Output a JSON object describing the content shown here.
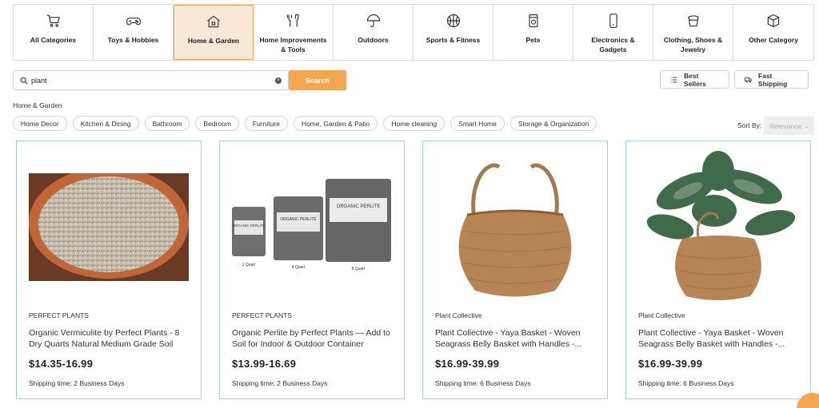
{
  "categories": [
    {
      "label": "All Categories",
      "icon": "cart-icon"
    },
    {
      "label": "Toys & Hobbies",
      "icon": "gamepad-icon"
    },
    {
      "label": "Home & Garden",
      "icon": "house-icon",
      "active": true
    },
    {
      "label": "Home Improvements & Tools",
      "icon": "tools-icon"
    },
    {
      "label": "Outdoors",
      "icon": "umbrella-icon"
    },
    {
      "label": "Sports & Fitness",
      "icon": "basketball-icon"
    },
    {
      "label": "Pets",
      "icon": "pet-food-icon"
    },
    {
      "label": "Electronics & Gadgets",
      "icon": "phone-icon"
    },
    {
      "label": "Clothing, Shoes & Jewelry",
      "icon": "hat-icon"
    },
    {
      "label": "Other Category",
      "icon": "box-icon"
    }
  ],
  "search": {
    "value": "plant",
    "button_label": "Search"
  },
  "toolbar": {
    "best_sellers": "Best Sellers",
    "fast_shipping": "Fast Shipping"
  },
  "breadcrumb": "Home & Garden",
  "subcategories": [
    "Home Decor",
    "Kitchen & Dining",
    "Bathroom",
    "Bedroom",
    "Furniture",
    "Home, Garden & Patio",
    "Home cleaning",
    "Smart Home",
    "Storage & Organization"
  ],
  "sort": {
    "label": "Sort By:",
    "value": "Relevance"
  },
  "products": [
    {
      "brand": "PERFECT PLANTS",
      "title": "Organic Vermiculite by Perfect Plants - 8 Dry Quarts Natural Medium Grade Soil Additive...",
      "price": "$14.35-16.99",
      "shipping": "Shipping time: 2 Business Days",
      "image": "vermiculite-pot"
    },
    {
      "brand": "PERFECT PLANTS",
      "title": "Organic Perlite by Perfect Plants — Add to Soil for Indoor & Outdoor Container Plants...",
      "price": "$13.99-16.69",
      "shipping": "Shipping time: 2 Business Days",
      "image": "perlite-bags",
      "bag_labels": [
        "1 Quart",
        "4 Quart",
        "8 Quart"
      ],
      "bag_brand": "ORGANIC PERLITE"
    },
    {
      "brand": "Plant Collective",
      "title": "Plant Collective - Yaya Basket - Woven Seagrass Belly Basket with Handles -...",
      "price": "$16.99-39.99",
      "shipping": "Shipping time: 6 Business Days",
      "image": "woven-basket"
    },
    {
      "brand": "Plant Collective",
      "title": "Plant Collective - Yaya Basket - Woven Seagrass Belly Basket with Handles -...",
      "price": "$16.99-39.99",
      "shipping": "Shipping time: 6 Business Days",
      "image": "basket-with-plant"
    }
  ],
  "colors": {
    "accent": "#f4a652",
    "active_bg": "#fbe7d6",
    "card_border": "#a8cde8"
  }
}
